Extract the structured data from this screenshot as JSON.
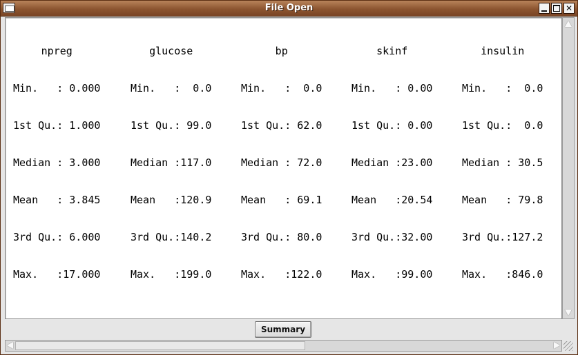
{
  "window": {
    "title": "File Open",
    "controls": {
      "minimize": "_",
      "maximize": "□",
      "close": "✕"
    }
  },
  "summary": {
    "columns": [
      {
        "header": "npreg",
        "rows": [
          "Min.   : 0.000",
          "1st Qu.: 1.000",
          "Median : 3.000",
          "Mean   : 3.845",
          "3rd Qu.: 6.000",
          "Max.   :17.000"
        ]
      },
      {
        "header": "glucose",
        "rows": [
          "Min.   :  0.0",
          "1st Qu.: 99.0",
          "Median :117.0",
          "Mean   :120.9",
          "3rd Qu.:140.2",
          "Max.   :199.0"
        ]
      },
      {
        "header": "bp",
        "rows": [
          "Min.   :  0.0",
          "1st Qu.: 62.0",
          "Median : 72.0",
          "Mean   : 69.1",
          "3rd Qu.: 80.0",
          "Max.   :122.0"
        ]
      },
      {
        "header": "skinf",
        "rows": [
          "Min.   : 0.00",
          "1st Qu.: 0.00",
          "Median :23.00",
          "Mean   :20.54",
          "3rd Qu.:32.00",
          "Max.   :99.00"
        ]
      },
      {
        "header": "insulin",
        "rows": [
          "Min.   :  0.0",
          "1st Qu.:  0.0",
          "Median : 30.5",
          "Mean   : 79.8",
          "3rd Qu.:127.2",
          "Max.   :846.0"
        ]
      }
    ]
  },
  "buttons": {
    "summary_label": "Summary"
  }
}
